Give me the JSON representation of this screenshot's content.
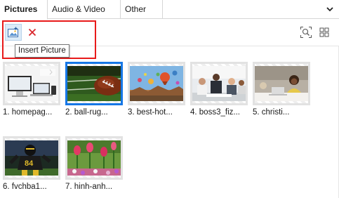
{
  "tabs": [
    {
      "label": "Pictures",
      "active": true
    },
    {
      "label": "Audio & Video",
      "active": false
    },
    {
      "label": "Other",
      "active": false
    }
  ],
  "toolbar": {
    "insert_icon": "insert-picture-icon",
    "delete_icon": "delete-icon",
    "zoom_icon": "zoom-fit-icon",
    "grid_icon": "grid-view-icon",
    "tooltip": "Insert Picture"
  },
  "colors": {
    "accent_selected": "#1677e6",
    "highlight": "#e81a1a",
    "delete_red": "#d9262b",
    "insert_bg": "#dcebf8"
  },
  "thumbnails": [
    {
      "label": "1. homepag...",
      "selected": false,
      "scene": "devices"
    },
    {
      "label": "2. ball-rug...",
      "selected": true,
      "scene": "football"
    },
    {
      "label": "3. best-hot...",
      "selected": false,
      "scene": "balloons"
    },
    {
      "label": "4. boss3_fiz...",
      "selected": false,
      "scene": "meeting"
    },
    {
      "label": "5. christi...",
      "selected": false,
      "scene": "woman-laptop"
    },
    {
      "label": "6. fvchba1...",
      "selected": false,
      "scene": "football-player"
    },
    {
      "label": "7. hinh-anh...",
      "selected": false,
      "scene": "tulips"
    }
  ]
}
